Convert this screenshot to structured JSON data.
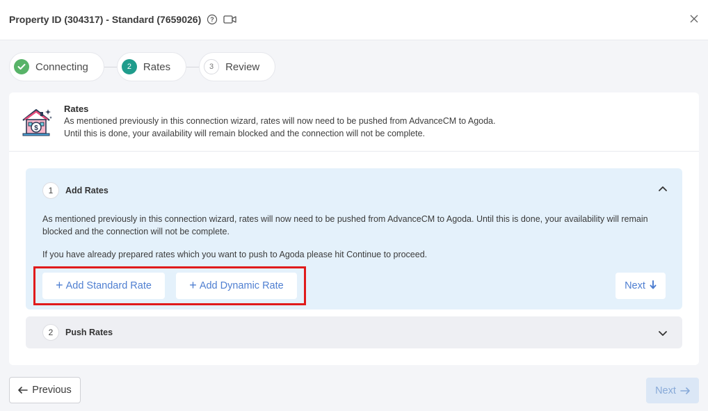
{
  "header": {
    "title": "Property ID (304317) - Standard (7659026)",
    "help_icon": "help-circle-icon",
    "video_icon": "video-camera-icon",
    "close_icon": "close-icon"
  },
  "steps": [
    {
      "label": "Connecting",
      "state": "done"
    },
    {
      "label": "Rates",
      "number": "2",
      "state": "active"
    },
    {
      "label": "Review",
      "number": "3",
      "state": "pending"
    }
  ],
  "rates_card": {
    "title": "Rates",
    "description_line1": "As mentioned previously in this connection wizard, rates will now need to be pushed from AdvanceCM to Agoda.",
    "description_line2": "Until this is done, your availability will remain blocked and the connection will not be complete."
  },
  "accordion": [
    {
      "number": "1",
      "title": "Add Rates",
      "expanded": true,
      "paragraph1": "As mentioned previously in this connection wizard, rates will now need to be pushed from AdvanceCM to Agoda. Until this is done, your availability will remain blocked and the connection will not be complete.",
      "paragraph2": "If you have already prepared rates which you want to push to Agoda please hit Continue to proceed.",
      "add_standard_label": "Add Standard Rate",
      "add_dynamic_label": "Add Dynamic Rate",
      "next_label": "Next",
      "next_icon": "arrow-down-icon"
    },
    {
      "number": "2",
      "title": "Push Rates",
      "expanded": false
    }
  ],
  "footer": {
    "previous_label": "Previous",
    "previous_icon": "arrow-left-icon",
    "next_label": "Next",
    "next_icon": "arrow-right-icon"
  },
  "colors": {
    "accent_teal": "#1f9c8c",
    "success_green": "#58b368",
    "link_blue": "#4f7fd1",
    "highlight_red": "#e01b1b",
    "panel_blue": "#e4f1fb"
  }
}
